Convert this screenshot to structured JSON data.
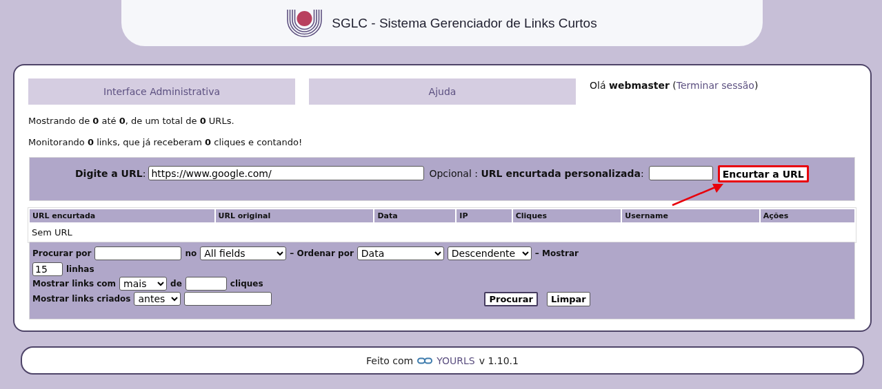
{
  "header": {
    "title": "SGLC - Sistema Gerenciador de Links Curtos"
  },
  "nav": {
    "tabs": [
      {
        "label": "Interface Administrativa"
      },
      {
        "label": "Ajuda"
      }
    ],
    "greeting_before": "Olá **webmaster** (",
    "logout_link": "Terminar sessão",
    "greeting_after": ")"
  },
  "stats": [
    "Mostrando de **0** até **0**, de um total de **0** URLs.",
    "Monitorando **0** links, que já receberam **0** cliques e contando!"
  ],
  "new_url": {
    "label": "**Digite a URL**:",
    "url_value": "https://www.google.com/",
    "optional_label": "Opcional : **URL encurtada personalizada**:",
    "button": {
      "label": "Encurtar a URL",
      "highlighted": true
    }
  },
  "table": {
    "columns": [
      "URL encurtada",
      "URL original",
      "Data",
      "IP",
      "Cliques",
      "Username",
      "Ações"
    ],
    "empty_message": "Sem URL"
  },
  "filters": {
    "lines": [
      [
        {
          "kind": "label",
          "text": "Procurar por"
        },
        {
          "kind": "field"
        },
        {
          "kind": "label",
          "text": "no"
        },
        {
          "kind": "select",
          "value": "All fields"
        },
        {
          "kind": "label",
          "text": "– Ordenar por"
        },
        {
          "kind": "select",
          "value": "Data"
        },
        {
          "kind": "select",
          "value": "Descendente"
        },
        {
          "kind": "label",
          "text": "– Mostrar"
        },
        {
          "kind": "field",
          "value": "15"
        },
        {
          "kind": "label",
          "text": "linhas"
        }
      ],
      [
        {
          "kind": "label",
          "text": "Mostrar links com"
        },
        {
          "kind": "select",
          "value": "mais"
        },
        {
          "kind": "label",
          "text": "de"
        },
        {
          "kind": "field"
        },
        {
          "kind": "label",
          "text": "cliques"
        }
      ],
      [
        {
          "kind": "label",
          "text": "Mostrar links criados"
        },
        {
          "kind": "select",
          "value": "antes"
        },
        {
          "kind": "field"
        },
        {
          "kind": "button",
          "text": "Procurar"
        },
        {
          "kind": "button",
          "text": "Limpar"
        }
      ]
    ]
  },
  "footer": {
    "text": "Feito com",
    "link": "YOURLS",
    "version": "v 1.10.1"
  }
}
